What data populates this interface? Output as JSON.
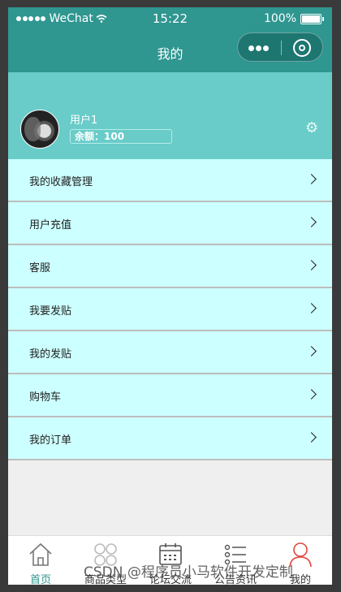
{
  "status_bar": {
    "carrier": "WeChat",
    "time": "15:22",
    "battery": "100%"
  },
  "nav": {
    "title": "我的"
  },
  "profile": {
    "username": "用户1",
    "balance_label": "余额：",
    "balance_value": "100"
  },
  "menu": [
    {
      "label": "我的收藏管理"
    },
    {
      "label": "用户充值"
    },
    {
      "label": "客服"
    },
    {
      "label": "我要发贴"
    },
    {
      "label": "我的发贴"
    },
    {
      "label": "购物车"
    },
    {
      "label": "我的订单"
    }
  ],
  "tabbar": {
    "tabs": [
      {
        "label": "首页",
        "icon": "home-icon",
        "active": true
      },
      {
        "label": "商品类型",
        "icon": "category-icon"
      },
      {
        "label": "论坛交流",
        "icon": "calendar-icon"
      },
      {
        "label": "公告资讯",
        "icon": "list-icon"
      },
      {
        "label": "我的",
        "icon": "user-icon"
      }
    ],
    "accent": "#2f9690",
    "active_user_color": "#e0453b"
  },
  "watermark": {
    "text": "CSDN @程序员小马软件开发定制"
  }
}
